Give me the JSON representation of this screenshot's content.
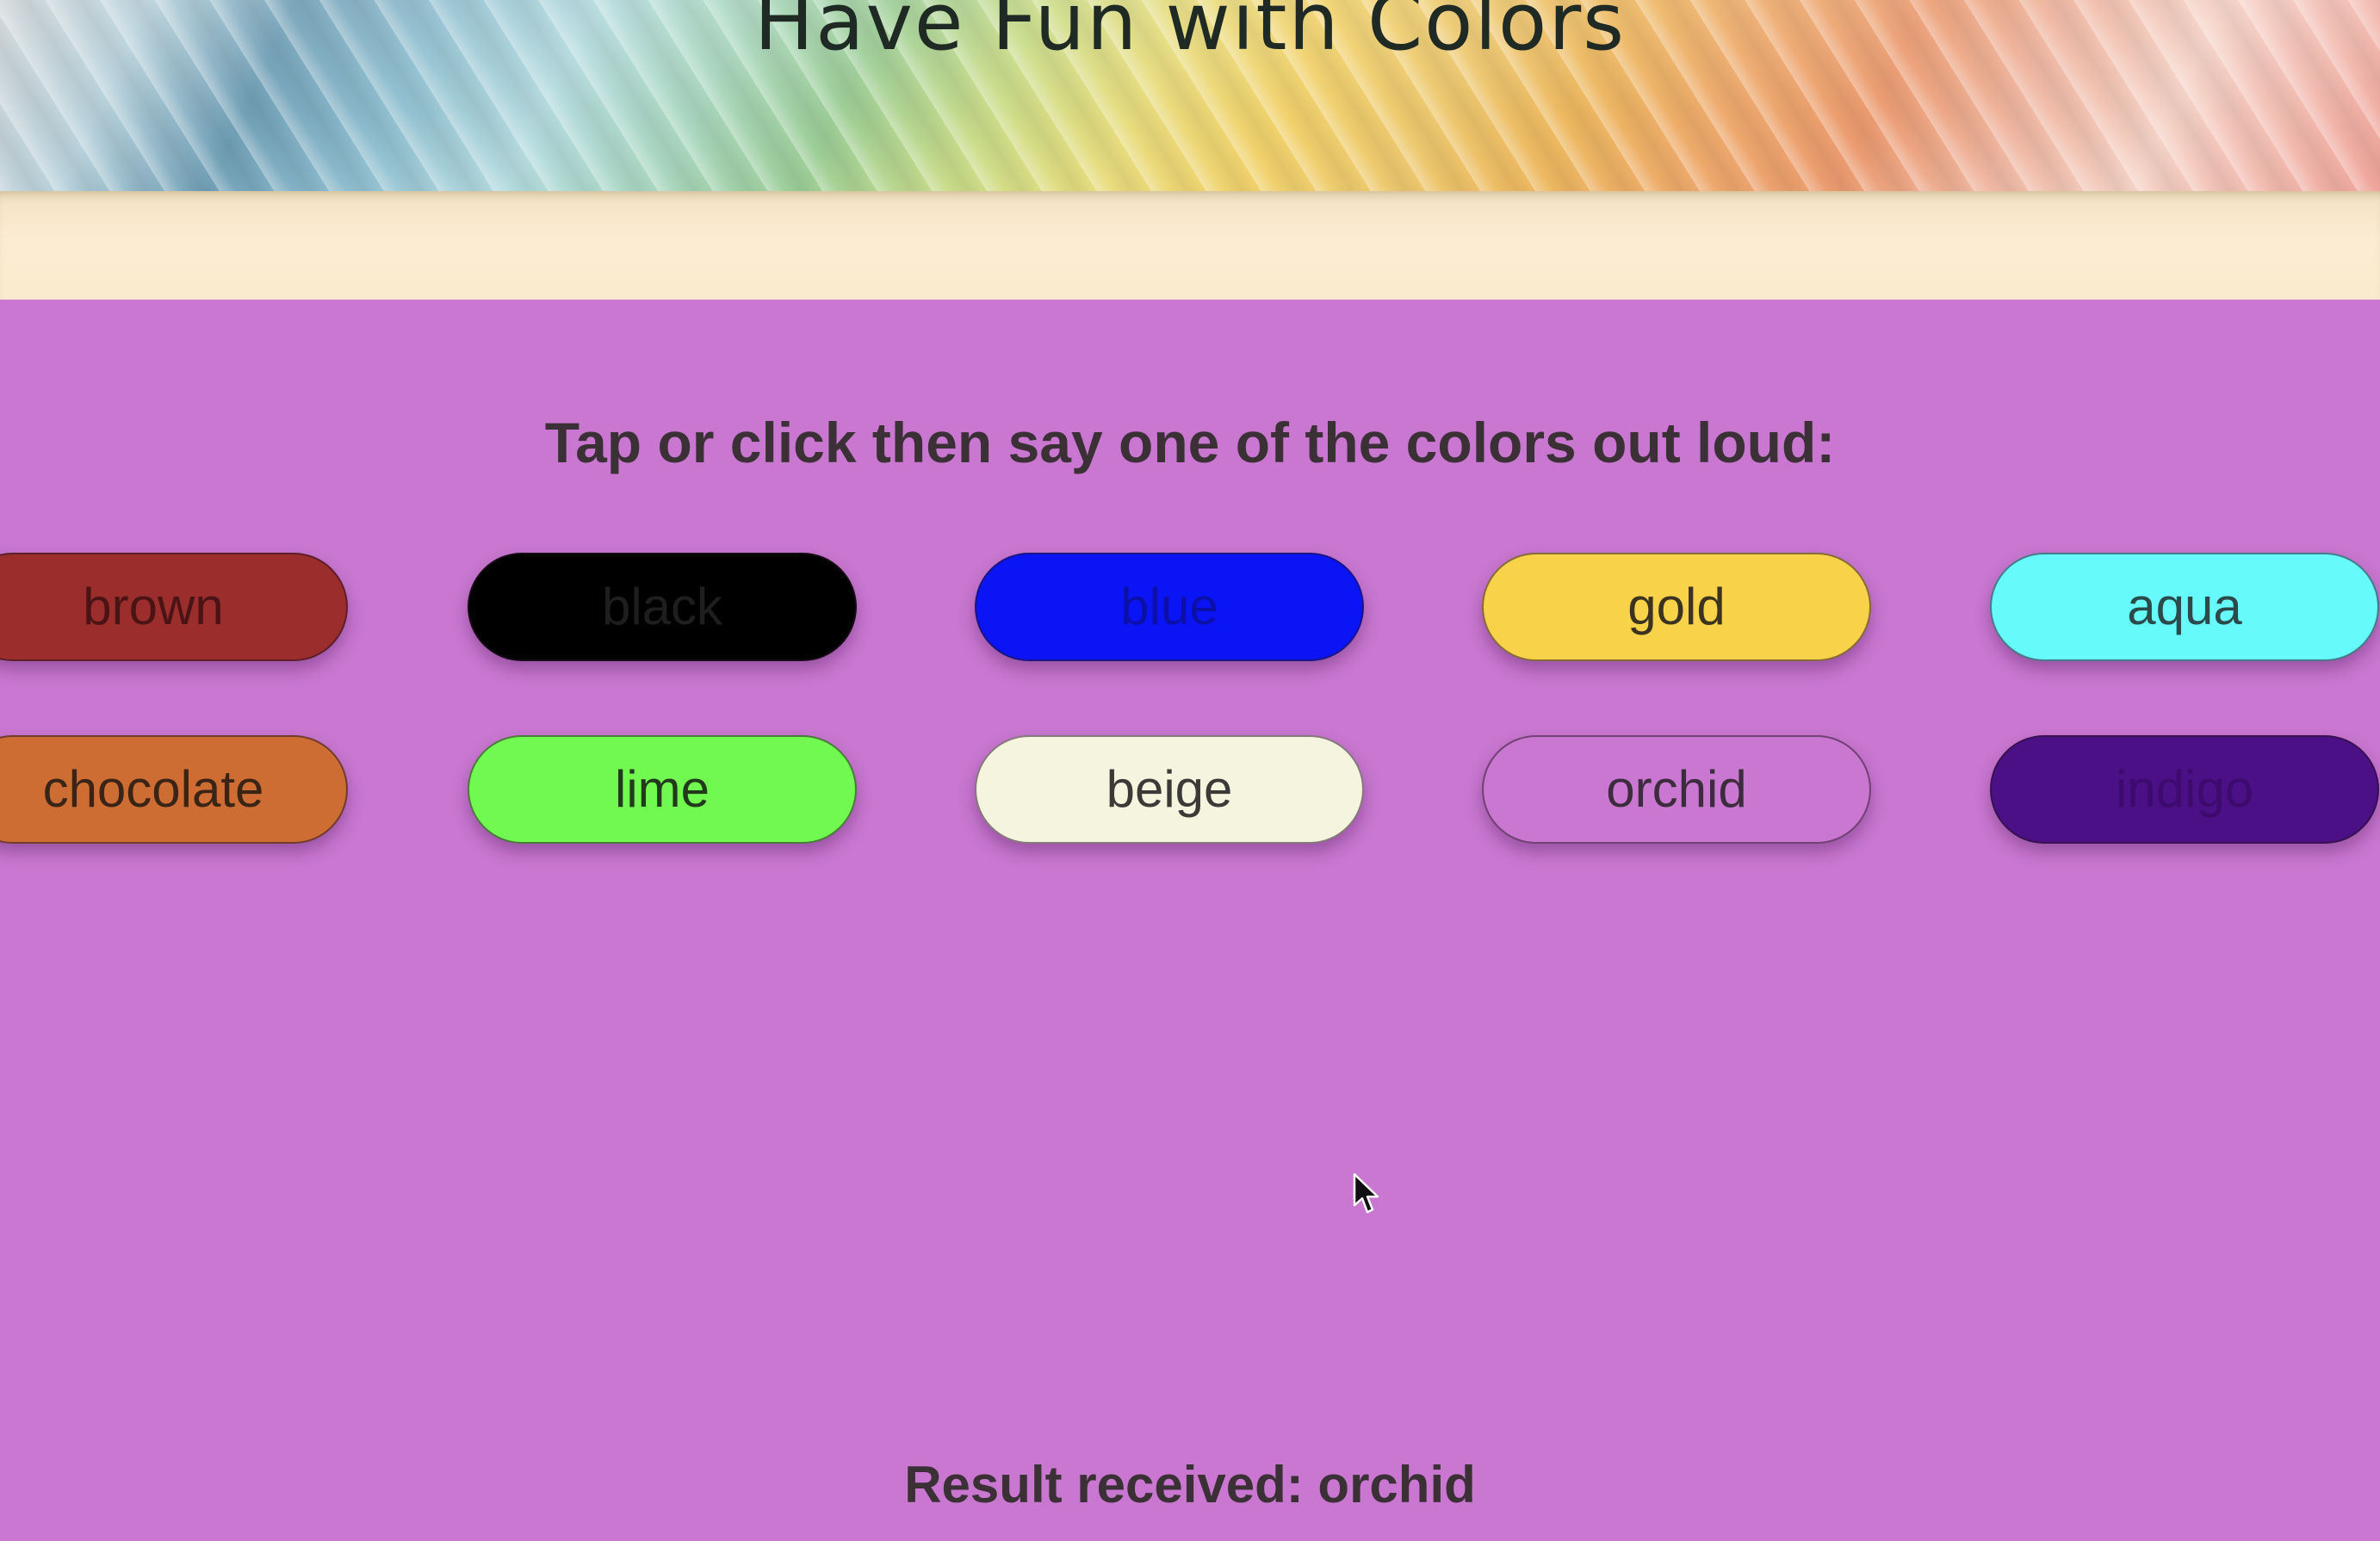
{
  "header": {
    "title": "Have Fun with Colors"
  },
  "main": {
    "instruction": "Tap or click then say one of the colors out loud:",
    "colors": [
      {
        "label": "brown",
        "bg": "#9b2d2d",
        "text": "#4a1414"
      },
      {
        "label": "black",
        "bg": "#000000",
        "text": "#1e1e1e"
      },
      {
        "label": "blue",
        "bg": "#0a14f5",
        "text": "#0b11a8"
      },
      {
        "label": "gold",
        "bg": "#f8d349",
        "text": "#3b3320"
      },
      {
        "label": "aqua",
        "bg": "#66fafa",
        "text": "#2d4a4a"
      },
      {
        "label": "chocolate",
        "bg": "#cd6d34",
        "text": "#3a2416"
      },
      {
        "label": "lime",
        "bg": "#72f951",
        "text": "#223a1c"
      },
      {
        "label": "beige",
        "bg": "#f5f4df",
        "text": "#3c3a36"
      },
      {
        "label": "orchid",
        "bg": "#c977d0",
        "text": "#3c2c3e"
      },
      {
        "label": "indigo",
        "bg": "#4b0f86",
        "text": "#3d0a6e"
      }
    ],
    "result": "Result received: orchid"
  },
  "theme": {
    "page_bg": "#c977d0",
    "band_bg": "#fcecd3",
    "text_dark": "#3a3036"
  },
  "icons": {
    "cursor": "mouse-pointer-icon"
  }
}
